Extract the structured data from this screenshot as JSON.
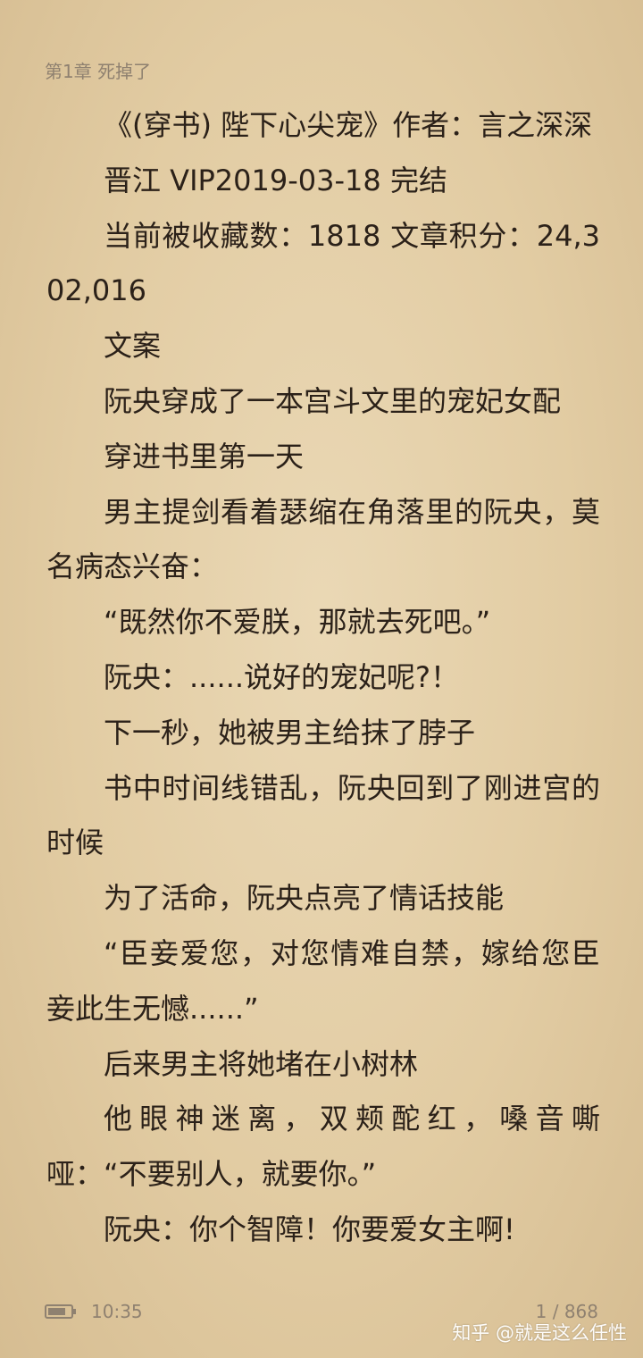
{
  "chapter_title": "第1章 死掉了",
  "paragraphs": [
    "《(穿书) 陛下心尖宠》作者：言之深深",
    "晋江 VIP2019-03-18 完结",
    "当前被收藏数：1818 文章积分：24,302,016",
    "文案",
    "阮央穿成了一本宫斗文里的宠妃女配",
    "穿进书里第一天",
    "男主提剑看着瑟缩在角落里的阮央，莫名病态兴奋：",
    "“既然你不爱朕，那就去死吧。”",
    "阮央：......说好的宠妃呢?！",
    "下一秒，她被男主给抹了脖子",
    "书中时间线错乱，阮央回到了刚进宫的时候",
    "为了活命，阮央点亮了情话技能",
    "“臣妾爱您，对您情难自禁，嫁给您臣妾此生无憾......”",
    "后来男主将她堵在小树林",
    "他眼神迷离，双颊酡红，嗓音嘶哑：“不要别人，就要你。”",
    "阮央：你个智障！你要爱女主啊!"
  ],
  "status_bar": {
    "battery_icon": "battery-icon",
    "battery_level": 0.8,
    "time": "10:35",
    "page": "1 / 868"
  },
  "watermark": "知乎 @就是这么任性",
  "colors": {
    "background": "#e2cca3",
    "text": "#2b2119",
    "muted": "#8f8170"
  }
}
